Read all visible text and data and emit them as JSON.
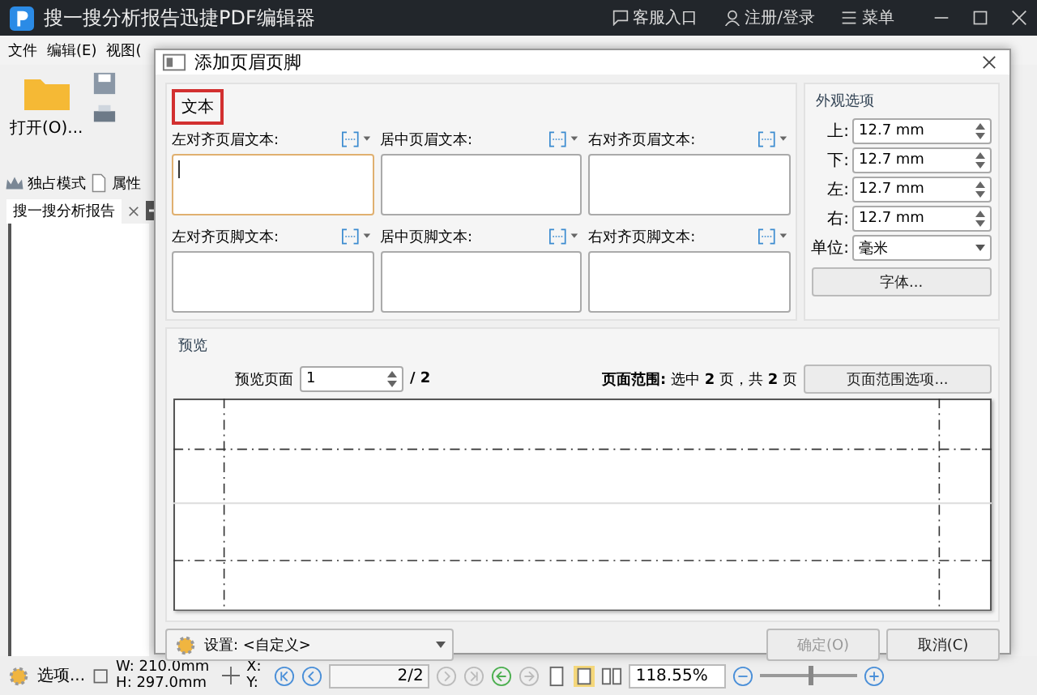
{
  "app": {
    "title": "搜一搜分析报告迅捷PDF编辑器",
    "header_links": [
      {
        "kind": "support",
        "label": "客服入口"
      },
      {
        "kind": "user",
        "label": "注册/登录"
      },
      {
        "kind": "menu",
        "label": "菜单"
      }
    ],
    "menu": [
      "文件",
      "编辑(E)",
      "视图("
    ],
    "toolbar": {
      "open_label": "打开(O)...",
      "exclusive_mode": "独占模式",
      "properties": "属性"
    },
    "document_tabs": [
      {
        "label": "搜一搜分析报告",
        "selected": true
      }
    ],
    "status_bar": {
      "options": "选项...",
      "width": "W: 210.0mm",
      "height": "H: 297.0mm",
      "x_label": "X:",
      "y_label": "Y:",
      "page": "2/2",
      "zoom": "118.55%",
      "zoom_slider": {
        "level": 0.5
      }
    }
  },
  "dialog": {
    "title": "添加页眉页脚",
    "text_group": {
      "title": "文本",
      "highlighted": true,
      "fields": [
        {
          "label": "左对齐页眉文本:",
          "focused": true
        },
        {
          "label": "居中页眉文本:",
          "focused": false
        },
        {
          "label": "右对齐页眉文本:",
          "focused": false
        },
        {
          "label": "左对齐页脚文本:",
          "focused": false
        },
        {
          "label": "居中页脚文本:",
          "focused": false
        },
        {
          "label": "右对齐页脚文本:",
          "focused": false
        }
      ]
    },
    "appearance": {
      "title": "外观选项",
      "margins": [
        {
          "label": "上:",
          "value": "12.7 mm"
        },
        {
          "label": "下:",
          "value": "12.7 mm"
        },
        {
          "label": "左:",
          "value": "12.7 mm"
        },
        {
          "label": "右:",
          "value": "12.7 mm"
        }
      ],
      "unit_label": "单位:",
      "unit": "毫米",
      "font_button": "字体..."
    },
    "preview": {
      "title": "预览",
      "page_label": "预览页面",
      "page": "1",
      "page_total": "/ 2",
      "range": "**页面范围:** 选中 **2** 页，共 **2** 页",
      "range_button": "页面范围选项..."
    },
    "settings": "设置: <自定义>",
    "buttons": [
      {
        "label": "确定(O)",
        "disabled": true
      },
      {
        "label": "取消(C)",
        "disabled": false
      }
    ]
  }
}
